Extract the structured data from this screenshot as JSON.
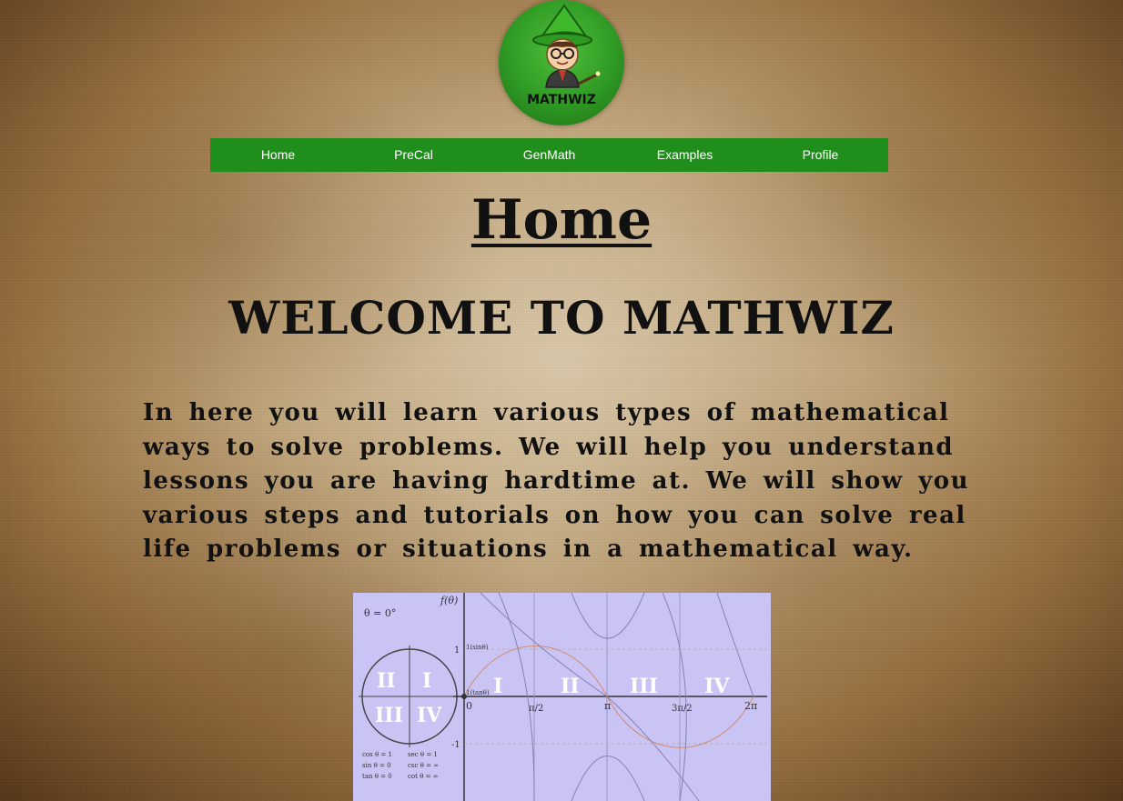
{
  "logo": {
    "text": "MATHWIZ",
    "icon": "wizard-mascot-icon"
  },
  "nav": {
    "items": [
      {
        "label": "Home"
      },
      {
        "label": "PreCal"
      },
      {
        "label": "GenMath"
      },
      {
        "label": "Examples"
      },
      {
        "label": "Profile"
      }
    ]
  },
  "main": {
    "title": "Home",
    "welcome": "WELCOME TO MATHWIZ",
    "intro": "In here you will learn various types of mathematical ways to solve problems. We will help you understand lessons you are having hardtime at. We will show you various steps and tutorials on how you can solve real life problems or situations in a mathematical way."
  },
  "graph": {
    "theta_label": "θ = 0°",
    "f_label": "f(θ)",
    "quadrants": [
      "II",
      "I",
      "III",
      "IV"
    ],
    "axis_quadrants": [
      "I",
      "II",
      "III",
      "IV"
    ],
    "x_ticks": [
      "0",
      "π/2",
      "π",
      "3π/2",
      "2π"
    ],
    "y_ticks": [
      "1",
      "-1"
    ],
    "small_labels": [
      "1(sinθ)",
      "1(tanθ)"
    ],
    "legend_left": [
      "cos θ = 1",
      "sin θ = 0",
      "tan θ = 0"
    ],
    "legend_right": [
      "sec θ = 1",
      "csc θ = ∞",
      "cot θ = ∞"
    ]
  },
  "colors": {
    "nav_bg": "#1f8e1a",
    "graph_bg": "#c9c4f4",
    "logo_bg": "#2f9a24"
  }
}
